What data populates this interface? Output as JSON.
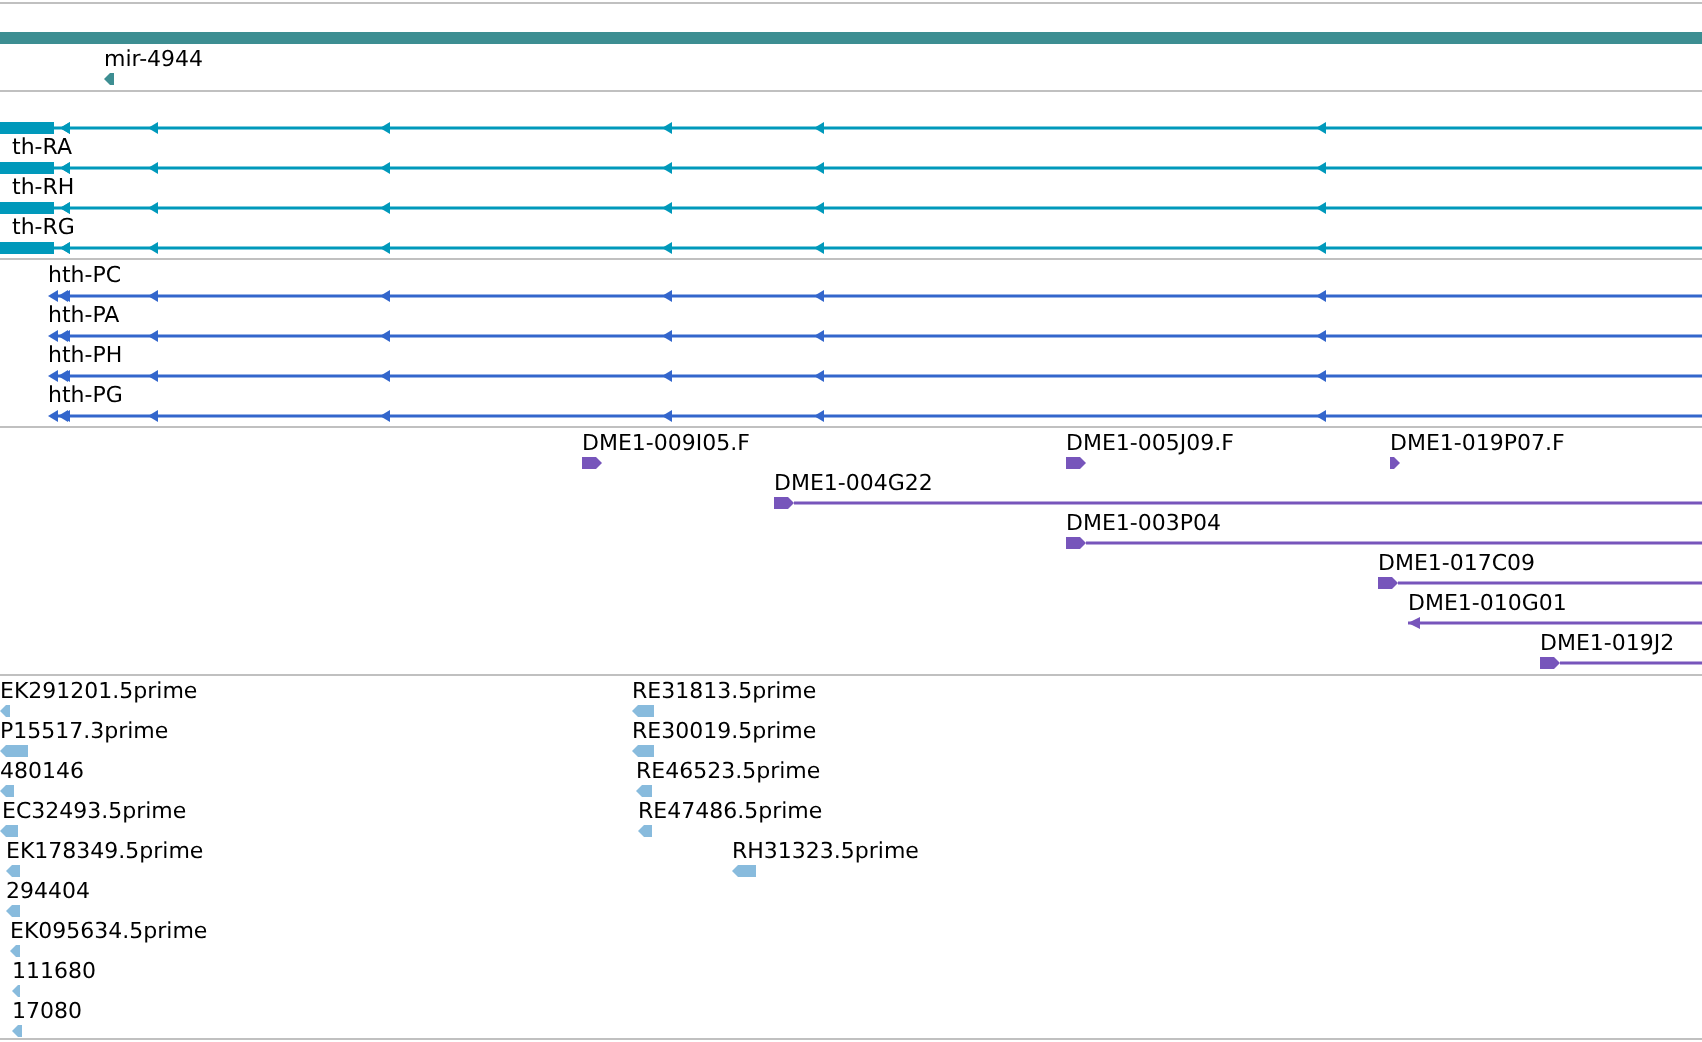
{
  "tracks": [
    {
      "kind": "gene",
      "features": [
        {
          "label": "mir-4944",
          "reverse": true,
          "kind": "end"
        }
      ]
    },
    {
      "kind": "rna",
      "features": [
        {
          "reverse": true,
          "kind": "transcript"
        },
        {
          "label": "th-RA",
          "reverse": true,
          "kind": "transcript"
        },
        {
          "label": "th-RH",
          "reverse": true,
          "kind": "transcript"
        },
        {
          "label": "th-RG",
          "reverse": true,
          "kind": "transcript"
        }
      ]
    },
    {
      "kind": "protein",
      "features": [
        {
          "label": "hth-PC",
          "reverse": true,
          "kind": "transcript"
        },
        {
          "label": "hth-PA",
          "reverse": true,
          "kind": "transcript"
        },
        {
          "label": "hth-PH",
          "reverse": true,
          "kind": "transcript"
        },
        {
          "label": "hth-PG",
          "reverse": true,
          "kind": "transcript"
        }
      ]
    },
    {
      "kind": "clone",
      "features": [
        {
          "label": "DME1-009I05.F",
          "reverse": false,
          "kind": "end"
        },
        {
          "label": "DME1-005J09.F",
          "reverse": false,
          "kind": "end"
        },
        {
          "label": "DME1-019P07.F",
          "reverse": false,
          "kind": "end"
        },
        {
          "label": "DME1-004G22",
          "reverse": false,
          "kind": "span"
        },
        {
          "label": "DME1-003P04",
          "reverse": false,
          "kind": "span"
        },
        {
          "label": "DME1-017C09",
          "reverse": false,
          "kind": "span"
        },
        {
          "label": "DME1-010G01",
          "reverse": true,
          "kind": "span"
        },
        {
          "label": "DME1-019J2",
          "reverse": false,
          "kind": "span"
        }
      ]
    },
    {
      "kind": "est",
      "features": [
        {
          "label": "EK291201.5prime",
          "reverse": true,
          "kind": "end"
        },
        {
          "label": "P15517.3prime",
          "reverse": true,
          "kind": "end"
        },
        {
          "label": "480146",
          "reverse": true,
          "kind": "end"
        },
        {
          "label": "EC32493.5prime",
          "reverse": true,
          "kind": "end"
        },
        {
          "label": "EK178349.5prime",
          "reverse": true,
          "kind": "end"
        },
        {
          "label": "294404",
          "reverse": true,
          "kind": "end"
        },
        {
          "label": "EK095634.5prime",
          "reverse": true,
          "kind": "end"
        },
        {
          "label": "111680",
          "reverse": true,
          "kind": "end"
        },
        {
          "label": "17080",
          "reverse": true,
          "kind": "end"
        },
        {
          "label": "RE31813.5prime",
          "reverse": true,
          "kind": "end"
        },
        {
          "label": "RE30019.5prime",
          "reverse": true,
          "kind": "end"
        },
        {
          "label": "RE46523.5prime",
          "reverse": true,
          "kind": "end"
        },
        {
          "label": "RE47486.5prime",
          "reverse": true,
          "kind": "end"
        },
        {
          "label": "RH31323.5prime",
          "reverse": true,
          "kind": "end"
        }
      ]
    }
  ]
}
